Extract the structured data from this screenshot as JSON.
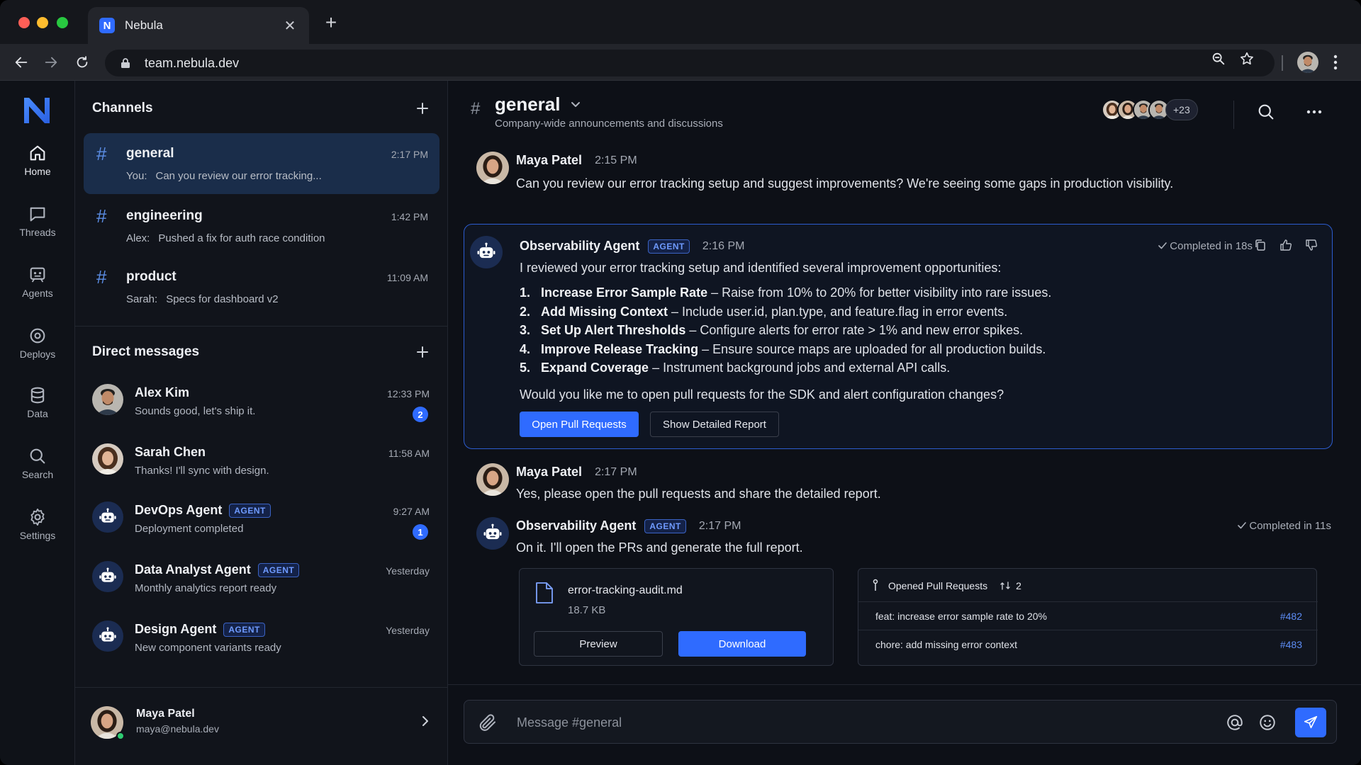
{
  "browser": {
    "tab_title": "Nebula",
    "favicon_letter": "N",
    "close_glyph": "✕",
    "newtab_glyph": "+",
    "url": "team.nebula.dev"
  },
  "rail": {
    "items": [
      {
        "label": "Home",
        "icon": "home-icon"
      },
      {
        "label": "Threads",
        "icon": "chat-bubble-icon"
      },
      {
        "label": "Agents",
        "icon": "bot-icon"
      },
      {
        "label": "Deploys",
        "icon": "deploy-icon"
      },
      {
        "label": "Data",
        "icon": "database-icon"
      },
      {
        "label": "Search",
        "icon": "search-icon"
      },
      {
        "label": "Settings",
        "icon": "gear-icon"
      }
    ]
  },
  "channels": {
    "title": "Channels",
    "items": [
      {
        "name": "general",
        "time": "2:17 PM",
        "who": "You:",
        "preview": "Can you review our error tracking..."
      },
      {
        "name": "engineering",
        "time": "1:42 PM",
        "who": "Alex:",
        "preview": "Pushed a fix for auth race condition"
      },
      {
        "name": "product",
        "time": "11:09 AM",
        "who": "Sarah:",
        "preview": "Specs for dashboard v2"
      }
    ]
  },
  "dms": {
    "title": "Direct messages",
    "agent_tag": "AGENT",
    "items": [
      {
        "name": "Alex Kim",
        "preview": "Sounds good, let's ship it.",
        "time": "12:33 PM",
        "badge": "2"
      },
      {
        "name": "Sarah Chen",
        "preview": "Thanks! I'll sync with design.",
        "time": "11:58 AM"
      },
      {
        "name": "DevOps Agent",
        "preview": "Deployment completed",
        "time": "9:27 AM",
        "badge": "1"
      },
      {
        "name": "Data Analyst Agent",
        "preview": "Monthly analytics report ready",
        "time": "Yesterday"
      },
      {
        "name": "Design Agent",
        "preview": "New component variants ready",
        "time": "Yesterday"
      }
    ]
  },
  "me": {
    "name": "Maya Patel",
    "email": "maya@nebula.dev"
  },
  "channel_header": {
    "title": "general",
    "description": "Company-wide announcements and discussions",
    "member_count": "+23"
  },
  "messages": {
    "m1": {
      "author": "Maya Patel",
      "time": "2:15 PM",
      "text": "Can you review our error tracking setup and suggest improvements? We're seeing some gaps in production visibility."
    },
    "m2": {
      "author": "Observability Agent",
      "tag": "AGENT",
      "time": "2:16 PM",
      "completed": "Completed in 18s",
      "intro": "I reviewed your error tracking setup and identified several improvement opportunities:",
      "items": [
        {
          "num": "1.",
          "title": "Increase Error Sample Rate",
          "desc": " – Raise from 10% to 20% for better visibility into rare issues."
        },
        {
          "num": "2.",
          "title": "Add Missing Context",
          "desc": " – Include user.id, plan.type, and feature.flag in error events."
        },
        {
          "num": "3.",
          "title": "Set Up Alert Thresholds",
          "desc": " – Configure alerts for error rate > 1% and new error spikes."
        },
        {
          "num": "4.",
          "title": "Improve Release Tracking",
          "desc": " – Ensure source maps are uploaded for all production builds."
        },
        {
          "num": "5.",
          "title": "Expand Coverage",
          "desc": " – Instrument background jobs and external API calls."
        }
      ],
      "question": "Would you like me to open pull requests for the SDK and alert configuration changes?",
      "primary_button": "Open Pull Requests",
      "secondary_button": "Show Detailed Report"
    },
    "m3": {
      "author": "Maya Patel",
      "time": "2:17 PM",
      "text": "Yes, please open the pull requests and share the detailed report."
    },
    "m4": {
      "author": "Observability Agent",
      "tag": "AGENT",
      "time": "2:17 PM",
      "completed": "Completed in 11s",
      "text": "On it. I'll open the PRs and generate the full report.",
      "file": {
        "name": "error-tracking-audit.md",
        "size": "18.7 KB",
        "preview_label": "Preview",
        "download_label": "Download"
      },
      "prs": {
        "title": "Opened Pull Requests",
        "count": "2",
        "items": [
          {
            "title": "feat: increase error sample rate to 20%",
            "num": "#482"
          },
          {
            "title": "chore: add missing error context",
            "num": "#483"
          }
        ]
      }
    }
  },
  "composer": {
    "placeholder": "Message #general"
  },
  "colors": {
    "accent": "#2f6bff",
    "background": "#0d1017",
    "active_channel": "#1a2d4a",
    "online": "#2ecc71"
  }
}
